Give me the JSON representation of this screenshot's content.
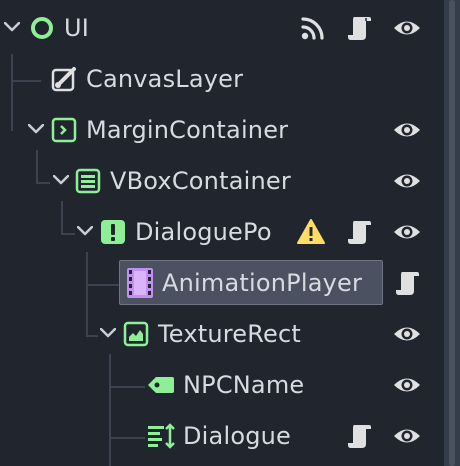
{
  "scene_tree": {
    "nodes": [
      {
        "label": "UI",
        "icon": "control-circle-icon",
        "expanded": true,
        "signals": true,
        "script": true,
        "visible": true
      },
      {
        "label": "CanvasLayer",
        "icon": "canvas-layer-icon",
        "expanded": false,
        "script": false,
        "visible": false
      },
      {
        "label": "MarginContainer",
        "icon": "margin-container-icon",
        "expanded": true,
        "visible": true
      },
      {
        "label": "VBoxContainer",
        "icon": "vbox-container-icon",
        "expanded": true,
        "visible": true
      },
      {
        "label": "DialoguePo",
        "icon": "panel-warning-icon",
        "expanded": true,
        "warning": true,
        "script": true,
        "visible": true
      },
      {
        "label": "AnimationPlayer",
        "icon": "animation-player-icon",
        "selected": true,
        "script": true
      },
      {
        "label": "TextureRect",
        "icon": "texture-rect-icon",
        "expanded": true,
        "visible": true
      },
      {
        "label": "NPCName",
        "icon": "label-icon",
        "visible": true
      },
      {
        "label": "Dialogue",
        "icon": "rich-text-label-icon",
        "script": true,
        "visible": true
      }
    ]
  },
  "colors": {
    "background": "#21262e",
    "control_green": "#8eef97",
    "canvas_white": "#e0e0e0",
    "animation_purple": "#c38ef1",
    "warning_yellow": "#ffdd65",
    "selection": "#4b5160"
  }
}
